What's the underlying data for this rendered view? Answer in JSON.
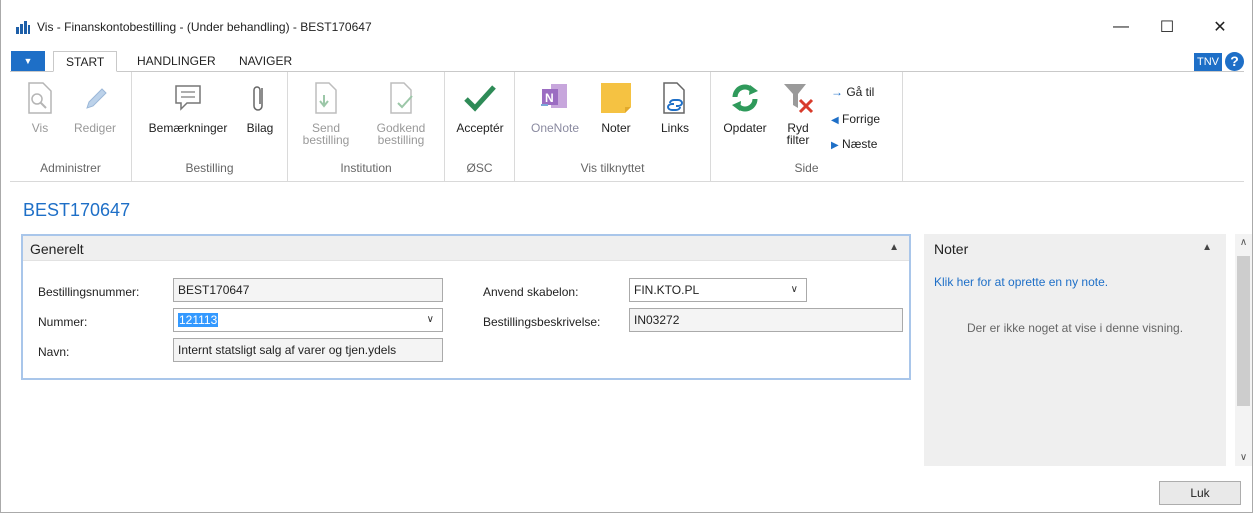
{
  "window": {
    "title": "Vis - Finanskontobestilling - (Under behandling) - BEST170647",
    "minimize": "—",
    "maximize": "☐",
    "close": "✕"
  },
  "tabs": [
    {
      "label": "START",
      "active": true
    },
    {
      "label": "HANDLINGER",
      "active": false
    },
    {
      "label": "NAVIGER",
      "active": false
    }
  ],
  "user_badge": "TNV",
  "help": "?",
  "ribbon": {
    "groups": {
      "administrer": "Administrer",
      "bestilling": "Bestilling",
      "institution": "Institution",
      "osc": "ØSC",
      "vis_tilknyttet": "Vis tilknyttet",
      "side": "Side"
    },
    "buttons": {
      "vis": "Vis",
      "rediger": "Rediger",
      "bemaerkninger": "Bemærkninger",
      "bilag": "Bilag",
      "send_1": "Send",
      "send_2": "bestilling",
      "godkend_1": "Godkend",
      "godkend_2": "bestilling",
      "accepter": "Acceptér",
      "onenote": "OneNote",
      "noter": "Noter",
      "links": "Links",
      "opdater": "Opdater",
      "ryd_1": "Ryd",
      "ryd_2": "filter",
      "gaa_til": "Gå til",
      "forrige": "Forrige",
      "naeste": "Næste"
    }
  },
  "page_title": "BEST170647",
  "generelt": {
    "title": "Generelt",
    "bestillingsnummer_label": "Bestillingsnummer:",
    "bestillingsnummer_value": "BEST170647",
    "nummer_label": "Nummer:",
    "nummer_value": "121113",
    "navn_label": "Navn:",
    "navn_value": "Internt statsligt salg af varer og tjen.ydels",
    "skabelon_label": "Anvend skabelon:",
    "skabelon_value": "FIN.KTO.PL",
    "beskrivelse_label": "Bestillingsbeskrivelse:",
    "beskrivelse_value": "IN03272"
  },
  "notes": {
    "title": "Noter",
    "create_link": "Klik her for at oprette en ny note.",
    "empty_text": "Der er ikke noget at vise i denne visning."
  },
  "close_button": "Luk",
  "colors": {
    "accent": "#1e6fc7",
    "ok_green": "#2e8b57",
    "onenote_purple": "#7b3fa5",
    "note_yellow": "#f5c242",
    "refresh_green": "#2f9a5b",
    "filter_red": "#d83b2b"
  }
}
